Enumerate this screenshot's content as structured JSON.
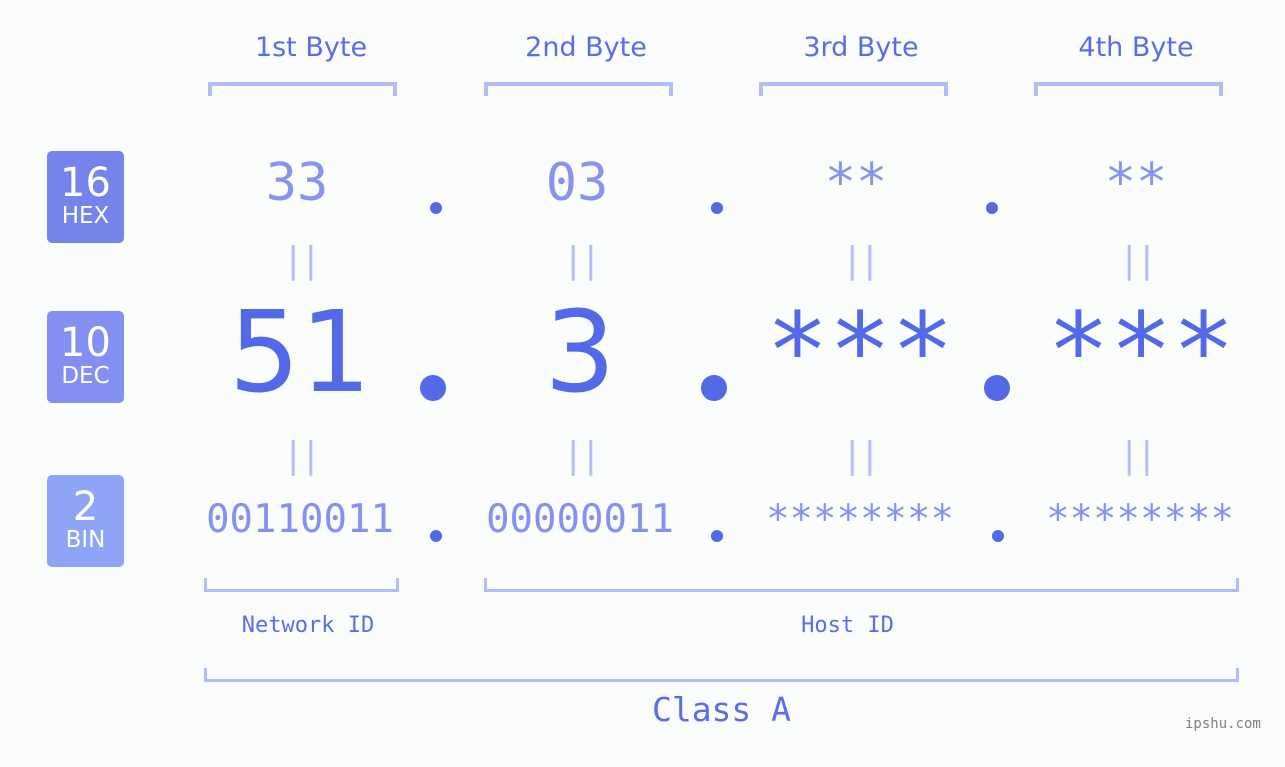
{
  "colors": {
    "background": "#fbfdfc",
    "accent": "#5269e8",
    "bracket": "#b3bcf5",
    "hex_badge": "#7583ec",
    "dec_badge": "#838ff1",
    "bin_badge": "#8ea5f6"
  },
  "bytes": [
    {
      "label": "1st Byte",
      "hex": "33",
      "dec": "51",
      "bin": "00110011"
    },
    {
      "label": "2nd Byte",
      "hex": "03",
      "dec": "3",
      "bin": "00000011"
    },
    {
      "label": "3rd Byte",
      "hex": "**",
      "dec": "***",
      "bin": "********"
    },
    {
      "label": "4th Byte",
      "hex": "**",
      "dec": "***",
      "bin": "********"
    }
  ],
  "badges": {
    "hex": {
      "number": "16",
      "label": "HEX"
    },
    "dec": {
      "number": "10",
      "label": "DEC"
    },
    "bin": {
      "number": "2",
      "label": "BIN"
    }
  },
  "equals_symbol": "||",
  "segments": {
    "network": "Network ID",
    "host": "Host ID"
  },
  "class_label": "Class A",
  "watermark": "ipshu.com"
}
